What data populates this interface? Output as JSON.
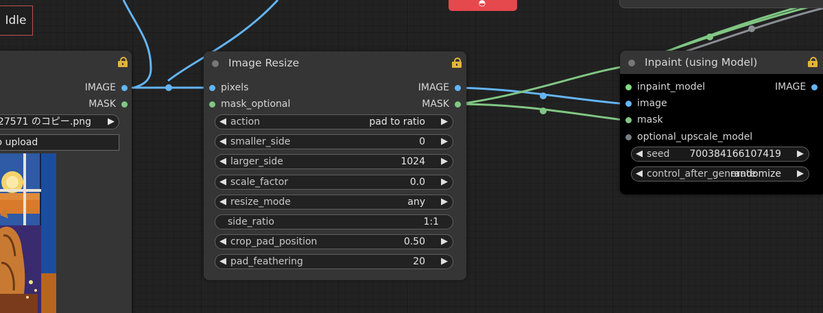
{
  "status": {
    "label": "Idle"
  },
  "load_image": {
    "outputs": [
      "IMAGE",
      "MASK"
    ],
    "file_value": "27571 のコピー.png",
    "upload_label": "e to upload"
  },
  "image_resize": {
    "title": "Image Resize",
    "inputs": [
      "pixels",
      "mask_optional"
    ],
    "outputs": [
      "IMAGE",
      "MASK"
    ],
    "widgets": [
      {
        "label": "action",
        "value": "pad to ratio"
      },
      {
        "label": "smaller_side",
        "value": "0"
      },
      {
        "label": "larger_side",
        "value": "1024"
      },
      {
        "label": "scale_factor",
        "value": "0.0"
      },
      {
        "label": "resize_mode",
        "value": "any"
      },
      {
        "label": "side_ratio",
        "value": "1:1"
      },
      {
        "label": "crop_pad_position",
        "value": "0.50"
      },
      {
        "label": "pad_feathering",
        "value": "20"
      }
    ]
  },
  "inpaint": {
    "title": "Inpaint (using Model)",
    "inputs": [
      "inpaint_model",
      "image",
      "mask",
      "optional_upscale_model"
    ],
    "outputs": [
      "IMAGE"
    ],
    "widgets": [
      {
        "label": "seed",
        "value": "700384166107419"
      },
      {
        "label": "control_after_generate",
        "value": "randomize"
      }
    ]
  },
  "colors": {
    "image_wire": "#64b5f6",
    "mask_wire": "#81c784",
    "grey_wire": "#8a8f95",
    "node_bg": "#353535",
    "lock": "#e2b43a",
    "accent_red": "#e5484d"
  }
}
